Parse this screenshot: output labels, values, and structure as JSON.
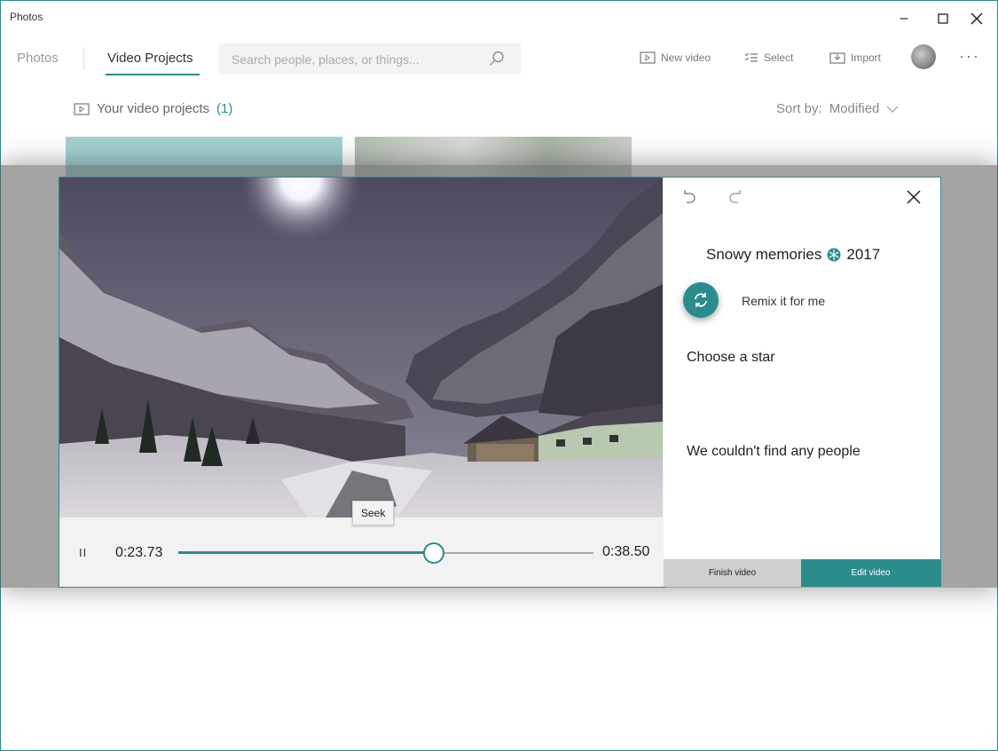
{
  "window": {
    "app_title": "Photos",
    "controls": {
      "minimize": "–",
      "maximize": "☐",
      "close": "✕"
    }
  },
  "nav": {
    "tabs": [
      {
        "label": "Photos",
        "active": false
      },
      {
        "label": "Video Projects",
        "active": true
      }
    ],
    "search": {
      "placeholder": "Search people, places, or things...",
      "value": ""
    },
    "commands": {
      "new_video": "New video",
      "select": "Select",
      "import": "Import",
      "more": "···"
    }
  },
  "projects": {
    "header_label": "Your video projects",
    "count": "(1)",
    "sort_label": "Sort by:",
    "sort_value": "Modified"
  },
  "player": {
    "pause_glyph": "II",
    "current_time": "0:23.73",
    "total_time": "0:38.50",
    "progress": 0.616,
    "tooltip": "Seek"
  },
  "editor_panel": {
    "project_title": "Snowy memories",
    "project_year": "2017",
    "remix_label": "Remix it for me",
    "choose_star_label": "Choose a star",
    "no_people_message": "We couldn't find any people",
    "finish_button": "Finish video",
    "edit_button": "Edit video"
  },
  "colors": {
    "accent": "#2b8c8c",
    "overlay": "#5a5a5a",
    "finish_bg": "#cfcfcf"
  }
}
